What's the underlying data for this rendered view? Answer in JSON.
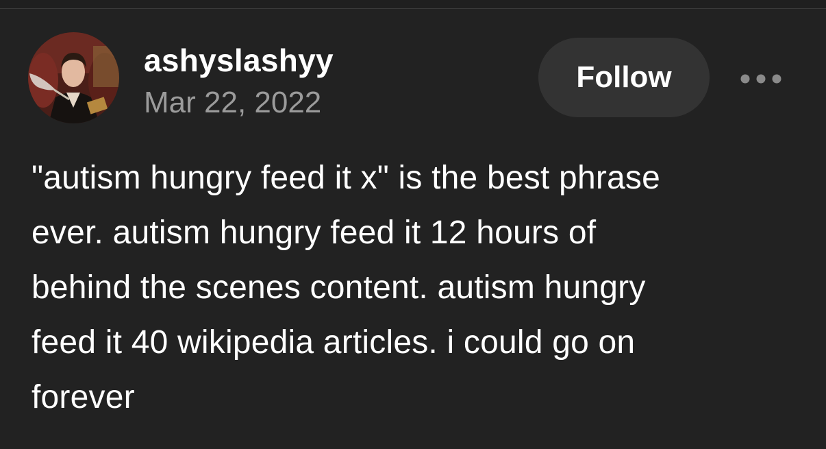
{
  "post": {
    "author": {
      "username": "ashyslashyy",
      "date": "Mar 22, 2022",
      "avatar_icon": "avatar-photo"
    },
    "follow_label": "Follow",
    "more_icon": "more-options-icon",
    "body_lines": [
      "\"autism hungry feed it x\" is the best phrase",
      "ever. autism hungry feed it 12 hours of",
      "behind the scenes content. autism hungry",
      "feed it 40 wikipedia articles. i could go on",
      "forever"
    ]
  },
  "colors": {
    "background": "#222222",
    "text_primary": "#ffffff",
    "text_secondary": "#9b9b9b",
    "button_bg": "#333333"
  }
}
